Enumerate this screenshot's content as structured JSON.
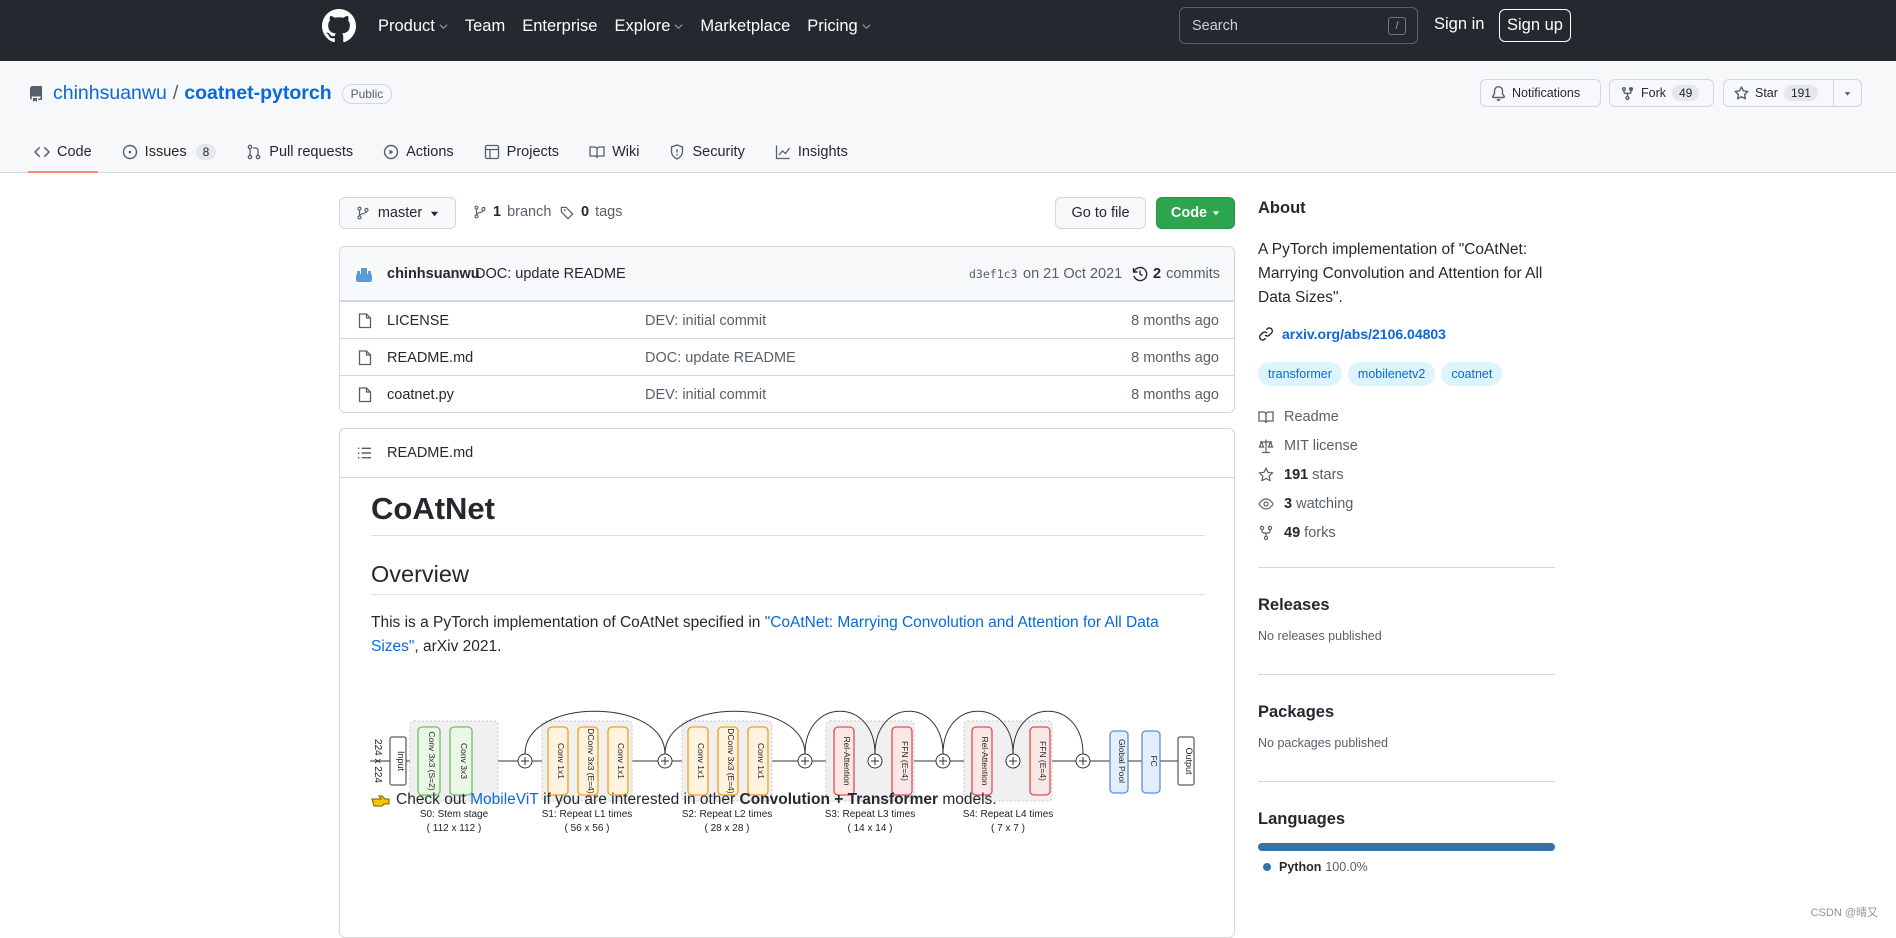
{
  "header": {
    "nav": [
      "Product",
      "Team",
      "Enterprise",
      "Explore",
      "Marketplace",
      "Pricing"
    ],
    "search_placeholder": "Search",
    "search_shortcut": "/",
    "sign_in": "Sign in",
    "sign_up": "Sign up"
  },
  "repo": {
    "owner": "chinhsuanwu",
    "name": "coatnet-pytorch",
    "visibility": "Public",
    "notifications_label": "Notifications",
    "fork_label": "Fork",
    "fork_count": "49",
    "star_label": "Star",
    "star_count": "191"
  },
  "tabs": [
    {
      "label": "Code",
      "count": ""
    },
    {
      "label": "Issues",
      "count": "8"
    },
    {
      "label": "Pull requests",
      "count": ""
    },
    {
      "label": "Actions",
      "count": ""
    },
    {
      "label": "Projects",
      "count": ""
    },
    {
      "label": "Wiki",
      "count": ""
    },
    {
      "label": "Security",
      "count": ""
    },
    {
      "label": "Insights",
      "count": ""
    }
  ],
  "toolbar": {
    "branch": "master",
    "branches_count": "1",
    "branches_label": "branch",
    "tags_count": "0",
    "tags_label": "tags",
    "go_to_file": "Go to file",
    "code_button": "Code"
  },
  "last_commit": {
    "author": "chinhsuanwu",
    "message": "DOC: update README",
    "sha": "d3ef1c3",
    "date": "on 21 Oct 2021",
    "commits_count": "2",
    "commits_label": "commits"
  },
  "files": [
    {
      "name": "LICENSE",
      "message": "DEV: initial commit",
      "age": "8 months ago"
    },
    {
      "name": "README.md",
      "message": "DOC: update README",
      "age": "8 months ago"
    },
    {
      "name": "coatnet.py",
      "message": "DEV: initial commit",
      "age": "8 months ago"
    }
  ],
  "readme": {
    "filename": "README.md",
    "title": "CoAtNet",
    "overview_heading": "Overview",
    "intro_before": "This is a PyTorch implementation of CoAtNet specified in ",
    "intro_link": "\"CoAtNet: Marrying Convolution and Attention for All Data Sizes\"",
    "intro_after": ", arXiv 2021.",
    "checkout_before": "Check out ",
    "checkout_link": "MobileViT",
    "checkout_middle": " if you are interested in other ",
    "checkout_bold": "Convolution + Transformer",
    "checkout_after": " models.",
    "diagram": {
      "input_size": "224 x 224",
      "input": "Input",
      "output": "Output",
      "s0_blocks": [
        "Conv 3x3 (S=2)",
        "Conv 3x3"
      ],
      "s1_blocks": [
        "Conv 1x1",
        "DConv 3x3 (E=4)",
        "Conv 1x1"
      ],
      "s2_blocks": [
        "Conv 1x1",
        "DConv 3x3 (E=4)",
        "Conv 1x1"
      ],
      "s3_blocks": [
        "Rel-Attention",
        "FFN (E=4)"
      ],
      "s4_blocks": [
        "Rel-Attention",
        "FFN (E=4)"
      ],
      "head_blocks": [
        "Global Pool",
        "FC"
      ],
      "stage_captions": [
        {
          "line1": "S0: Stem stage",
          "line2": "( 112 x 112 )"
        },
        {
          "line1": "S1: Repeat L1 times",
          "line2": "( 56 x 56 )"
        },
        {
          "line1": "S2: Repeat L2 times",
          "line2": "( 28 x 28 )"
        },
        {
          "line1": "S3: Repeat L3 times",
          "line2": "( 14 x 14 )"
        },
        {
          "line1": "S4: Repeat L4 times",
          "line2": "( 7 x 7 )"
        }
      ]
    }
  },
  "about": {
    "heading": "About",
    "description": "A PyTorch implementation of \"CoAtNet: Marrying Convolution and Attention for All Data Sizes\".",
    "link": "arxiv.org/abs/2106.04803",
    "topics": [
      "transformer",
      "mobilenetv2",
      "coatnet"
    ],
    "stats": [
      {
        "icon": "book-icon",
        "count": "",
        "label": "Readme"
      },
      {
        "icon": "law-icon",
        "count": "",
        "label": "MIT license"
      },
      {
        "icon": "star-icon",
        "count": "191",
        "label": "stars"
      },
      {
        "icon": "eye-icon",
        "count": "3",
        "label": "watching"
      },
      {
        "icon": "fork-icon",
        "count": "49",
        "label": "forks"
      }
    ]
  },
  "releases": {
    "heading": "Releases",
    "text": "No releases published"
  },
  "packages": {
    "heading": "Packages",
    "text": "No packages published"
  },
  "languages": {
    "heading": "Languages",
    "items": [
      {
        "name": "Python",
        "percent": "100.0%",
        "share": 1.0,
        "color": "#3572A5"
      }
    ]
  },
  "watermark": "CSDN @晴又",
  "colors": {
    "header_bg": "#24292f",
    "link": "#0969da",
    "green": "#2da44e",
    "active_tab": "#fd8c73"
  }
}
